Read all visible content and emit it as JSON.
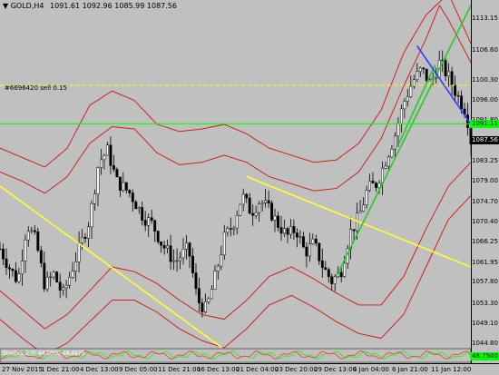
{
  "header": {
    "symbol_label": "GOLD,H4",
    "ohlc_label": "1091.61 1092.96 1085.99 1087.56"
  },
  "order_line": {
    "label": "#6696420 sell 0.15",
    "price": 1099.2
  },
  "price_axis": {
    "ticks": [
      "1113.15",
      "1106.60",
      "1100.30",
      "1096.00",
      "1091.80",
      "1083.25",
      "1079.00",
      "1074.70",
      "1070.40",
      "1066.25",
      "1061.95",
      "1057.80",
      "1053.30",
      "1049.10",
      "1044.80"
    ],
    "current_price_label": "1087.56",
    "level_label": "1091.11",
    "level_price": 1091.11
  },
  "time_axis": {
    "ticks": [
      "27 Nov 2015",
      "1 Dec 21:00",
      "4 Dec 13:00",
      "9 Dec 05:00",
      "11 Dec 21:00",
      "16 Dec 13:00",
      "21 Dec 04:00",
      "23 Dec 20:00",
      "29 Dec 13:00",
      "4 Jan 04:00",
      "6 Jan 21:00",
      "11 Jan 12:00"
    ]
  },
  "indicator": {
    "label": "Stoch(5,3,3) 44.0000 48.4975",
    "value_label": "48.7500"
  },
  "colors": {
    "background": "#c0c0c0",
    "candle": "#000000",
    "bands": "#d11010",
    "trend_yellow": "#ffff33",
    "trend_green": "#22cc22",
    "trend_blue": "#3340ff",
    "level_line": "#00ff00",
    "order_line": "#ffff00"
  },
  "chart_data": {
    "type": "candlestick",
    "symbol": "GOLD",
    "timeframe": "H4",
    "y_range": [
      1044.0,
      1116.0
    ],
    "candle_count": 150,
    "close_path": [
      [
        0,
        1064.8
      ],
      [
        4,
        1061.0
      ],
      [
        8,
        1058.0
      ],
      [
        12,
        1070.0
      ],
      [
        16,
        1066.5
      ],
      [
        20,
        1057.0
      ],
      [
        24,
        1059.5
      ],
      [
        28,
        1055.0
      ],
      [
        34,
        1063.0
      ],
      [
        40,
        1071.0
      ],
      [
        44,
        1083.0
      ],
      [
        48,
        1085.5
      ],
      [
        52,
        1079.0
      ],
      [
        58,
        1076.5
      ],
      [
        64,
        1071.5
      ],
      [
        68,
        1070.0
      ],
      [
        72,
        1066.0
      ],
      [
        78,
        1062.0
      ],
      [
        84,
        1065.0
      ],
      [
        88,
        1054.0
      ],
      [
        92,
        1052.0
      ],
      [
        96,
        1059.0
      ],
      [
        100,
        1067.0
      ],
      [
        104,
        1070.0
      ],
      [
        108,
        1076.0
      ],
      [
        112,
        1072.5
      ],
      [
        116,
        1075.0
      ],
      [
        120,
        1073.0
      ],
      [
        124,
        1070.0
      ],
      [
        128,
        1067.5
      ],
      [
        132,
        1069.0
      ],
      [
        136,
        1064.0
      ],
      [
        140,
        1066.0
      ],
      [
        144,
        1061.0
      ],
      [
        148,
        1058.0
      ],
      [
        152,
        1060.0
      ],
      [
        156,
        1068.0
      ],
      [
        160,
        1071.5
      ],
      [
        164,
        1077.5
      ],
      [
        168,
        1078.5
      ],
      [
        172,
        1083.5
      ],
      [
        176,
        1088.5
      ],
      [
        180,
        1095.5
      ],
      [
        184,
        1100.0
      ],
      [
        188,
        1102.5
      ],
      [
        192,
        1099.5
      ],
      [
        196,
        1104.0
      ],
      [
        200,
        1101.0
      ],
      [
        204,
        1097.0
      ],
      [
        208,
        1093.5
      ],
      [
        210,
        1087.6
      ]
    ],
    "bollinger_upper": [
      [
        0,
        1081.0
      ],
      [
        10,
        1079.0
      ],
      [
        20,
        1076.5
      ],
      [
        30,
        1080.0
      ],
      [
        40,
        1087.0
      ],
      [
        50,
        1090.5
      ],
      [
        60,
        1090.0
      ],
      [
        70,
        1085.0
      ],
      [
        80,
        1082.5
      ],
      [
        90,
        1083.0
      ],
      [
        100,
        1084.5
      ],
      [
        110,
        1083.0
      ],
      [
        120,
        1080.0
      ],
      [
        130,
        1078.5
      ],
      [
        140,
        1077.0
      ],
      [
        150,
        1077.5
      ],
      [
        160,
        1081.0
      ],
      [
        170,
        1088.0
      ],
      [
        180,
        1099.0
      ],
      [
        190,
        1109.0
      ],
      [
        196,
        1116.0
      ],
      [
        200,
        1113.0
      ],
      [
        210,
        1104.0
      ]
    ],
    "bollinger_lower": [
      [
        0,
        1056.0
      ],
      [
        10,
        1052.0
      ],
      [
        20,
        1048.0
      ],
      [
        30,
        1051.0
      ],
      [
        40,
        1056.0
      ],
      [
        50,
        1061.0
      ],
      [
        60,
        1060.0
      ],
      [
        70,
        1057.5
      ],
      [
        80,
        1054.0
      ],
      [
        90,
        1051.0
      ],
      [
        100,
        1050.0
      ],
      [
        110,
        1054.0
      ],
      [
        120,
        1059.0
      ],
      [
        130,
        1061.0
      ],
      [
        140,
        1058.5
      ],
      [
        150,
        1055.5
      ],
      [
        160,
        1053.0
      ],
      [
        170,
        1053.0
      ],
      [
        180,
        1059.0
      ],
      [
        190,
        1069.0
      ],
      [
        200,
        1078.0
      ],
      [
        210,
        1083.0
      ]
    ],
    "bollinger_upper_wide": [
      [
        0,
        1086.0
      ],
      [
        10,
        1084.0
      ],
      [
        20,
        1082.0
      ],
      [
        30,
        1086.0
      ],
      [
        40,
        1095.0
      ],
      [
        50,
        1098.0
      ],
      [
        60,
        1096.0
      ],
      [
        70,
        1091.0
      ],
      [
        80,
        1089.5
      ],
      [
        90,
        1090.0
      ],
      [
        100,
        1091.0
      ],
      [
        110,
        1089.0
      ],
      [
        120,
        1086.0
      ],
      [
        130,
        1084.5
      ],
      [
        140,
        1083.0
      ],
      [
        150,
        1083.5
      ],
      [
        160,
        1087.0
      ],
      [
        170,
        1094.0
      ],
      [
        180,
        1106.0
      ],
      [
        190,
        1114.0
      ],
      [
        200,
        1118.5
      ],
      [
        210,
        1108.0
      ]
    ],
    "bollinger_lower_wide": [
      [
        0,
        1050.0
      ],
      [
        10,
        1046.0
      ],
      [
        20,
        1042.5
      ],
      [
        30,
        1045.0
      ],
      [
        40,
        1049.5
      ],
      [
        50,
        1054.0
      ],
      [
        60,
        1054.0
      ],
      [
        70,
        1051.5
      ],
      [
        80,
        1048.0
      ],
      [
        90,
        1045.5
      ],
      [
        100,
        1044.0
      ],
      [
        110,
        1048.0
      ],
      [
        120,
        1053.0
      ],
      [
        130,
        1055.0
      ],
      [
        140,
        1052.5
      ],
      [
        150,
        1049.5
      ],
      [
        160,
        1047.0
      ],
      [
        170,
        1046.0
      ],
      [
        180,
        1051.0
      ],
      [
        190,
        1061.0
      ],
      [
        200,
        1071.0
      ],
      [
        210,
        1076.0
      ]
    ],
    "trend_lines": [
      {
        "color": "yellow",
        "from": [
          0,
          1078.0
        ],
        "to": [
          99,
          1044.0
        ]
      },
      {
        "color": "yellow",
        "from": [
          110,
          1080.0
        ],
        "to": [
          210,
          1061.0
        ]
      },
      {
        "color": "green",
        "from": [
          150,
          1059.0
        ],
        "to": [
          210,
          1116.0
        ]
      },
      {
        "color": "green",
        "from": [
          178,
          1087.0
        ],
        "to": [
          194,
          1103.5
        ]
      },
      {
        "color": "blue",
        "from": [
          186,
          1107.5
        ],
        "to": [
          210,
          1091.0
        ]
      }
    ]
  }
}
